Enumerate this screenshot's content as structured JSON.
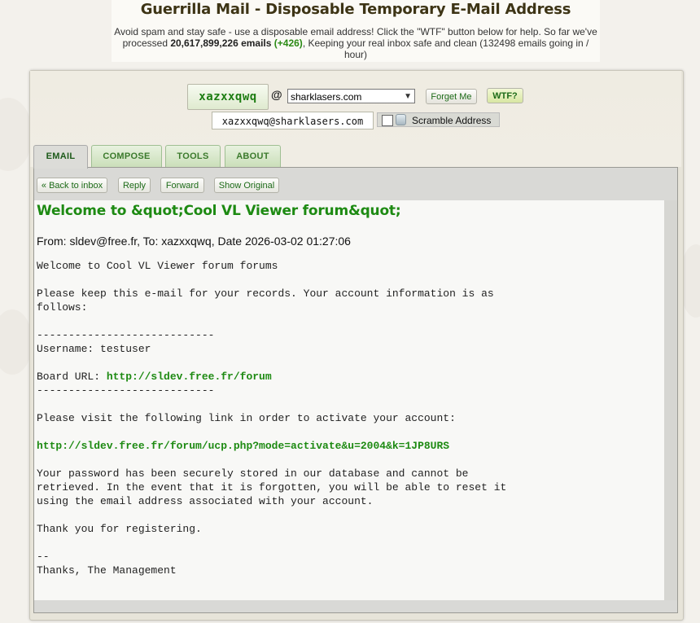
{
  "header": {
    "title": "Guerrilla Mail - Disposable Temporary E-Mail Address",
    "tagline_pre": "Avoid spam and stay safe - use a disposable email address! Click the \"WTF\" button below for help. So far we've processed ",
    "email_count": "20,617,899,226 emails",
    "increment": "(+426)",
    "tagline_post": ", Keeping your real inbox safe and clean (132498 emails going in / hour)"
  },
  "address": {
    "username": "xazxxqwq",
    "at_symbol": "@",
    "domain": "sharklasers.com",
    "full_address": "xazxxqwq@sharklasers.com",
    "forget_label": "Forget Me",
    "wtf_label": "WTF?",
    "scramble_label": "Scramble Address"
  },
  "tabs": [
    {
      "label": "EMAIL"
    },
    {
      "label": "COMPOSE"
    },
    {
      "label": "TOOLS"
    },
    {
      "label": "ABOUT"
    }
  ],
  "toolbar": {
    "back_label": "« Back to inbox",
    "reply_label": "Reply",
    "forward_label": "Forward",
    "original_label": "Show Original"
  },
  "message": {
    "subject": "Welcome to &quot;Cool VL Viewer forum&quot;",
    "from_label": "From: ",
    "from": "sldev@free.fr",
    "to_label": ", To: ",
    "to": "xazxxqwq",
    "date_label": ", Date ",
    "date": "2026-03-02 01:27:06",
    "body_part1": "Welcome to Cool VL Viewer forum forums\n\nPlease keep this e-mail for your records. Your account information is as\nfollows:\n\n----------------------------\nUsername: testuser\n\nBoard URL: ",
    "board_url": "http://sldev.free.fr/forum",
    "body_part2": "\n----------------------------\n\nPlease visit the following link in order to activate your account:\n\n",
    "activate_url": "http://sldev.free.fr/forum/ucp.php?mode=activate&u=2004&k=1JP8URS",
    "body_part3": "\n\nYour password has been securely stored in our database and cannot be\nretrieved. In the event that it is forgotten, you will be able to reset it\nusing the email address associated with your account.\n\nThank you for registering.\n\n--\nThanks, The Management"
  }
}
